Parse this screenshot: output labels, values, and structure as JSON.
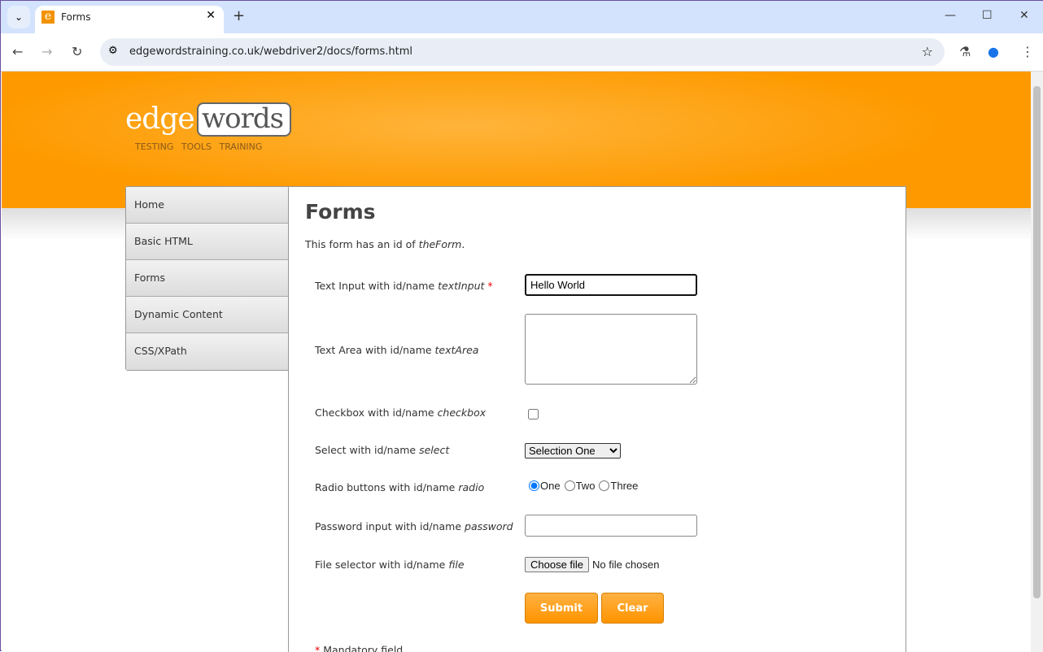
{
  "browser": {
    "tab_title": "Forms",
    "url": "edgewordstraining.co.uk/webdriver2/docs/forms.html"
  },
  "logo": {
    "edge": "edge",
    "words": "words",
    "tagline": "TESTING TOOLS TRAINING"
  },
  "sidenav": [
    "Home",
    "Basic HTML",
    "Forms",
    "Dynamic Content",
    "CSS/XPath"
  ],
  "page": {
    "title": "Forms",
    "intro_prefix": "This form has an id of ",
    "intro_id": "theForm",
    "intro_suffix": "."
  },
  "form": {
    "text_label": "Text Input with id/name ",
    "text_id": "textInput",
    "required_mark": "*",
    "text_value": "Hello World",
    "area_label": "Text Area with id/name ",
    "area_id": "textArea",
    "checkbox_label": "Checkbox with id/name ",
    "checkbox_id": "checkbox",
    "checkbox_checked": false,
    "select_label": "Select with id/name ",
    "select_id": "select",
    "select_value": "Selection One",
    "radio_label": "Radio buttons with id/name ",
    "radio_id": "radio",
    "radio_options": [
      "One",
      "Two",
      "Three"
    ],
    "radio_selected": "One",
    "password_label": "Password input with id/name ",
    "password_id": "password",
    "file_label": "File selector with id/name ",
    "file_id": "file",
    "file_button": "Choose file",
    "file_status": "No file chosen",
    "submit": "Submit",
    "clear": "Clear",
    "mandatory": "Mandatory field"
  },
  "colors": {
    "brand_orange": "#fe9a00"
  }
}
